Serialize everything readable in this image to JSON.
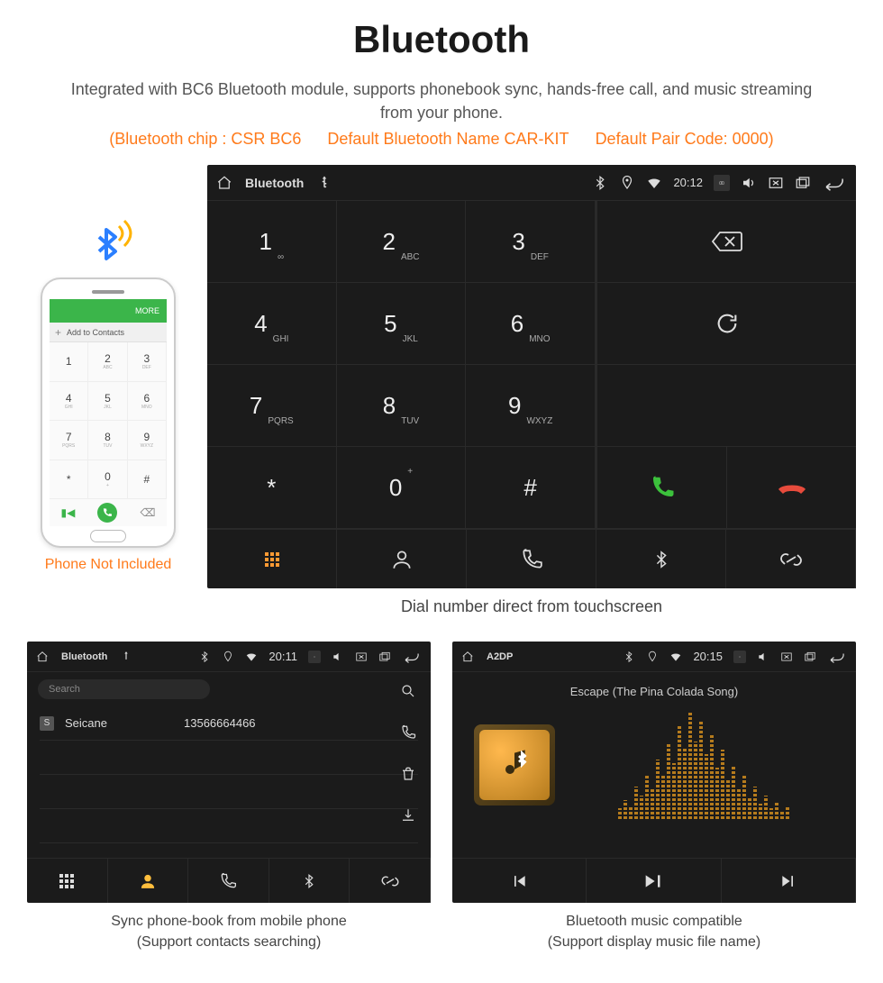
{
  "title": "Bluetooth",
  "description": "Integrated with BC6 Bluetooth module, supports phonebook sync, hands-free call, and music streaming from your phone.",
  "spec": {
    "chip": "(Bluetooth chip : CSR BC6",
    "name": "Default Bluetooth Name CAR-KIT",
    "code": "Default Pair Code: 0000)"
  },
  "phone": {
    "topbar_left": "",
    "topbar_right": "MORE",
    "addbar": "Add to Contacts",
    "keys": [
      {
        "n": "1",
        "l": ""
      },
      {
        "n": "2",
        "l": "ABC"
      },
      {
        "n": "3",
        "l": "DEF"
      },
      {
        "n": "4",
        "l": "GHI"
      },
      {
        "n": "5",
        "l": "JKL"
      },
      {
        "n": "6",
        "l": "MNO"
      },
      {
        "n": "7",
        "l": "PQRS"
      },
      {
        "n": "8",
        "l": "TUV"
      },
      {
        "n": "9",
        "l": "WXYZ"
      },
      {
        "n": "*",
        "l": ""
      },
      {
        "n": "0",
        "l": "+"
      },
      {
        "n": "#",
        "l": ""
      }
    ],
    "caption": "Phone Not Included"
  },
  "dialer": {
    "header_title": "Bluetooth",
    "time": "20:12",
    "keys": [
      {
        "n": "1",
        "l": "∞"
      },
      {
        "n": "2",
        "l": "ABC"
      },
      {
        "n": "3",
        "l": "DEF"
      },
      {
        "n": "4",
        "l": "GHI"
      },
      {
        "n": "5",
        "l": "JKL"
      },
      {
        "n": "6",
        "l": "MNO"
      },
      {
        "n": "7",
        "l": "PQRS"
      },
      {
        "n": "8",
        "l": "TUV"
      },
      {
        "n": "9",
        "l": "WXYZ"
      },
      {
        "n": "*",
        "l": ""
      },
      {
        "n": "0",
        "l": "+",
        "sup": true
      },
      {
        "n": "#",
        "l": ""
      }
    ],
    "caption": "Dial number direct from touchscreen"
  },
  "phonebook": {
    "header_title": "Bluetooth",
    "time": "20:11",
    "search_placeholder": "Search",
    "contact_badge": "S",
    "contact_name": "Seicane",
    "contact_number": "13566664466",
    "caption_line1": "Sync phone-book from mobile phone",
    "caption_line2": "(Support contacts searching)"
  },
  "a2dp": {
    "header_title": "A2DP",
    "time": "20:15",
    "song": "Escape (The Pina Colada Song)",
    "viz_bars": [
      10,
      18,
      12,
      30,
      22,
      40,
      28,
      55,
      42,
      70,
      52,
      88,
      66,
      100,
      72,
      90,
      60,
      78,
      48,
      64,
      38,
      50,
      28,
      40,
      20,
      30,
      14,
      22,
      10,
      16,
      8,
      12
    ],
    "caption_line1": "Bluetooth music compatible",
    "caption_line2": "(Support display music file name)"
  }
}
